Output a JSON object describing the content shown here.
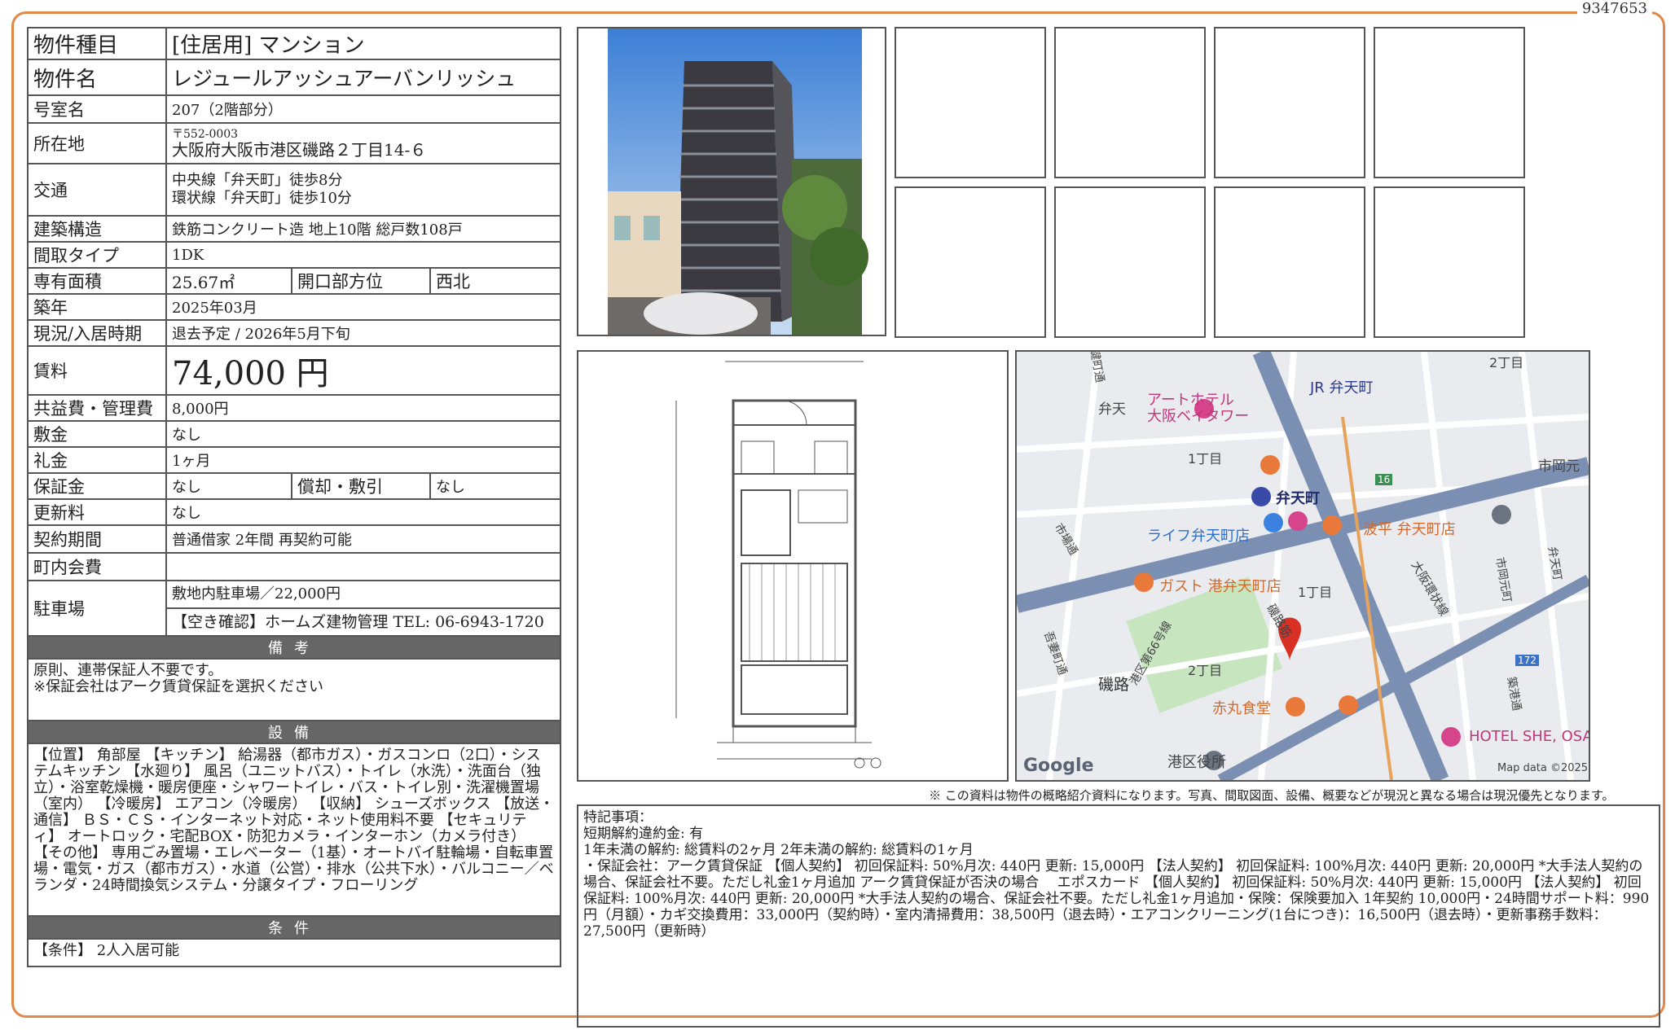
{
  "doc_id": "9347653",
  "left": {
    "type_label": "物件種目",
    "type_value": "[住居用]  マンション",
    "name_label": "物件名",
    "name_value": "レジュールアッシュアーバンリッシュ",
    "room_label": "号室名",
    "room_value": "207（2階部分）",
    "addr_label": "所在地",
    "postal": "〒552-0003",
    "addr_value": "大阪府大阪市港区磯路２丁目14-６",
    "access_label": "交通",
    "access1": "中央線「弁天町」徒歩8分",
    "access2": "環状線「弁天町」徒歩10分",
    "struct_label": "建築構造",
    "struct_value": "鉄筋コンクリート造  地上10階  総戸数108戸",
    "layout_label": "間取タイプ",
    "layout_value": "1DK",
    "area_label": "専有面積",
    "area_value": "25.67㎡",
    "dir_label": "開口部方位",
    "dir_value": "西北",
    "built_label": "築年",
    "built_value": "2025年03月",
    "status_label": "現況/入居時期",
    "status_value": "退去予定  /  2026年5月下旬",
    "rent_label": "賃料",
    "rent_value": "74,000 円",
    "fee_label": "共益費・管理費",
    "fee_value": "8,000円",
    "deposit_label": "敷金",
    "deposit_value": "なし",
    "key_label": "礼金",
    "key_value": "1ヶ月",
    "guar_label": "保証金",
    "guar_value": "なし",
    "amort_label": "償却・敷引",
    "amort_value": "なし",
    "renew_label": "更新料",
    "renew_value": "なし",
    "contract_label": "契約期間",
    "contract_value": "普通借家  2年間  再契約可能",
    "town_label": "町内会費",
    "town_value": "",
    "parking_label": "駐車場",
    "parking_value": "敷地内駐車場／22,000円",
    "contact": "【空き確認】ホームズ建物管理    TEL: 06-6943-1720",
    "remarks_title": "備考",
    "remarks": "原則、連帯保証人不要です。\n※保証会社はアーク賃貸保証を選択ください",
    "equip_title": "設備",
    "equip": "【位置】 角部屋 【キッチン】 給湯器（都市ガス）・ガスコンロ（2口）・システムキッチン 【水廻り】 風呂（ユニットバス）・トイレ（水洗）・洗面台（独立）・浴室乾燥機・暖房便座・シャワートイレ・バス・トイレ別・洗濯機置場（室内） 【冷暖房】 エアコン（冷暖房） 【収納】 シューズボックス 【放送・通信】 ＢＳ・ＣＳ・インターネット対応・ネット使用料不要 【セキュリティ】 オートロック・宅配BOX・防犯カメラ・インターホン（カメラ付き） 【その他】 専用ごみ置場・エレベーター（1基）・オートバイ駐輪場・自転車置場・電気・ガス（都市ガス）・水道（公営）・排水（公共下水）・バルコニー／ベランダ・24時間換気システム・分譲タイプ・フローリング",
    "cond_title": "条件",
    "cond": "【条件】 2人入居可能"
  },
  "disclaimer": "※ この資料は物件の概略紹介資料になります。写真、間取図面、設備、概要などが現況と異なる場合は現況優先となります。",
  "special": {
    "title": "特記事項：",
    "l1": "短期解約違約金: 有",
    "l2": "1年未満の解約: 総賃料の2ヶ月    2年未満の解約: 総賃料の1ヶ月",
    "l3": "・保証会社：アーク賃貸保証 【個人契約】 初回保証料: 50%月次: 440円 更新: 15,000円 【法人契約】 初回保証料: 100%月次: 440円 更新: 20,000円 *大手法人契約の場合、保証会社不要。ただし礼金1ヶ月追加 アーク賃貸保証が否決の場合　 エポスカード 【個人契約】 初回保証料: 50%月次: 440円 更新: 15,000円 【法人契約】 初回保証料: 100%月次: 440円 更新: 20,000円 *大手法人契約の場合、保証会社不要。ただし礼金1ヶ月追加・保険：保険要加入 1年契約 10,000円・24時間サポート料：990円（月額）・カギ交換費用：33,000円（契約時）・室内清掃費用：38,500円（退去時）・エアコンクリーニング(1台につき)：16,500円（退去時）・更新事務手数料：27,500円（更新時）"
  },
  "map": {
    "labels": {
      "bentencho_jr": "JR 弁天町",
      "hotel": "アートホテル\n大阪ベイタワー",
      "benten": "弁天",
      "itchome_n": "1丁目",
      "nichome_ne": "2丁目",
      "ichioka": "市岡元",
      "bentencho": "弁天町",
      "life": "ライフ弁天町店",
      "hanami": "波平 弁天町店",
      "gusto": "ガスト 港弁天町店",
      "itchome_s": "1丁目",
      "isoji_dori": "磯路筋",
      "nichome": "2丁目",
      "isoji": "磯路",
      "akamaru": "赤丸食堂",
      "hotel_she": "HOTEL SHE, OSAK",
      "ward": "港区役所",
      "google": "Google",
      "mapdata": "Map data ©2025",
      "r16": "16",
      "r172": "172",
      "osaka_kanjo": "大阪環状線",
      "route66": "港区第66号線",
      "ichioka_st": "市場通",
      "ichioka_dori": "市岡元町",
      "benten_st": "弁天町",
      "sakura": "築港通",
      "tenpo": "寺鍵町通",
      "itchome_w": "吾妻町通"
    },
    "colors": {
      "road_major": "#7b8fb3",
      "road_minor": "#ffffff",
      "park": "#c7e6c0",
      "block": "#e6e8eb",
      "poi_orange": "#e8793a",
      "poi_pink": "#d6458b",
      "poi_blue": "#3b82e0",
      "pin": "#d93025"
    }
  },
  "icons": {
    "pin": "map-pin-icon",
    "rest": "restaurant-icon",
    "shop": "shopping-icon",
    "hotel": "hotel-icon",
    "train": "train-icon"
  }
}
